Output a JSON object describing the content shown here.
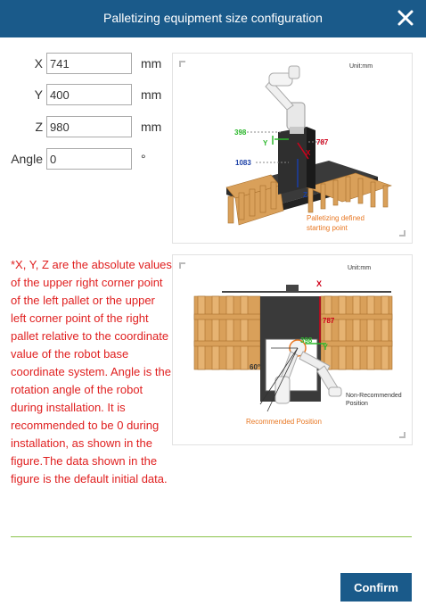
{
  "dialog": {
    "title": "Palletizing equipment size configuration",
    "close_icon": "close-icon"
  },
  "fields": [
    {
      "label": "X",
      "value": "741",
      "unit": "mm"
    },
    {
      "label": "Y",
      "value": "400",
      "unit": "mm"
    },
    {
      "label": "Z",
      "value": "980",
      "unit": "mm"
    },
    {
      "label": "Angle",
      "value": "0",
      "unit": "°"
    }
  ],
  "figure1": {
    "unit": "Unit:mm",
    "dim_y": "398",
    "dim_x": "787",
    "dim_z": "1083",
    "axis_y": "Y",
    "axis_x": "X",
    "axis_z": "Z",
    "caption_line1": "Palletizing defined",
    "caption_line2": "starting point"
  },
  "figure2": {
    "unit": "Unit:mm",
    "axis_x": "X",
    "dim_x": "787",
    "dim_y": "398",
    "axis_y": "Y",
    "angle": "60°",
    "non_recommended_line1": "Non-Recommended",
    "non_recommended_line2": "Position",
    "recommended": "Recommended Position"
  },
  "note": "*X, Y, Z are the absolute values of the upper right corner point of the left pallet or the upper left corner point of the right pallet relative to the coordinate value of the robot base coordinate system. Angle is the rotation angle of the robot during installation. It is recommended to be 0 during installation, as shown in the figure.The data shown in the figure is the default initial data.",
  "footer": {
    "confirm_label": "Confirm"
  },
  "colors": {
    "header": "#1a5a8a",
    "note_text": "#e02020",
    "divider": "#8bc34a",
    "dim_green": "#2db82d",
    "dim_red": "#d0021b",
    "dim_blue": "#1a3fa6",
    "caption_orange": "#e87722"
  }
}
